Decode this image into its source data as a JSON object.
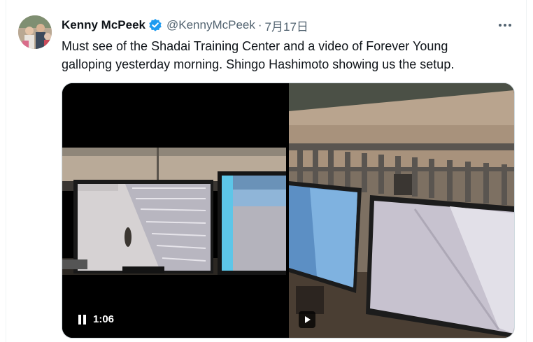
{
  "tweet": {
    "author_name": "Kenny McPeek",
    "handle": "@KennyMcPeek",
    "separator": "·",
    "date": "7月17日",
    "text": "Must see of the Shadai Training Center and a video of Forever Young galloping yesterday morning. Shingo Hashimoto showing us the setup."
  },
  "media": {
    "video": {
      "duration": "1:06",
      "state": "playing"
    }
  },
  "colors": {
    "verified": "#1d9bf0",
    "text_primary": "#0f1419",
    "text_secondary": "#536471",
    "border": "#cfd9de"
  },
  "icons": {
    "verified": "verified-badge-icon",
    "more": "more-options-icon",
    "pause": "pause-icon",
    "play": "play-icon"
  }
}
